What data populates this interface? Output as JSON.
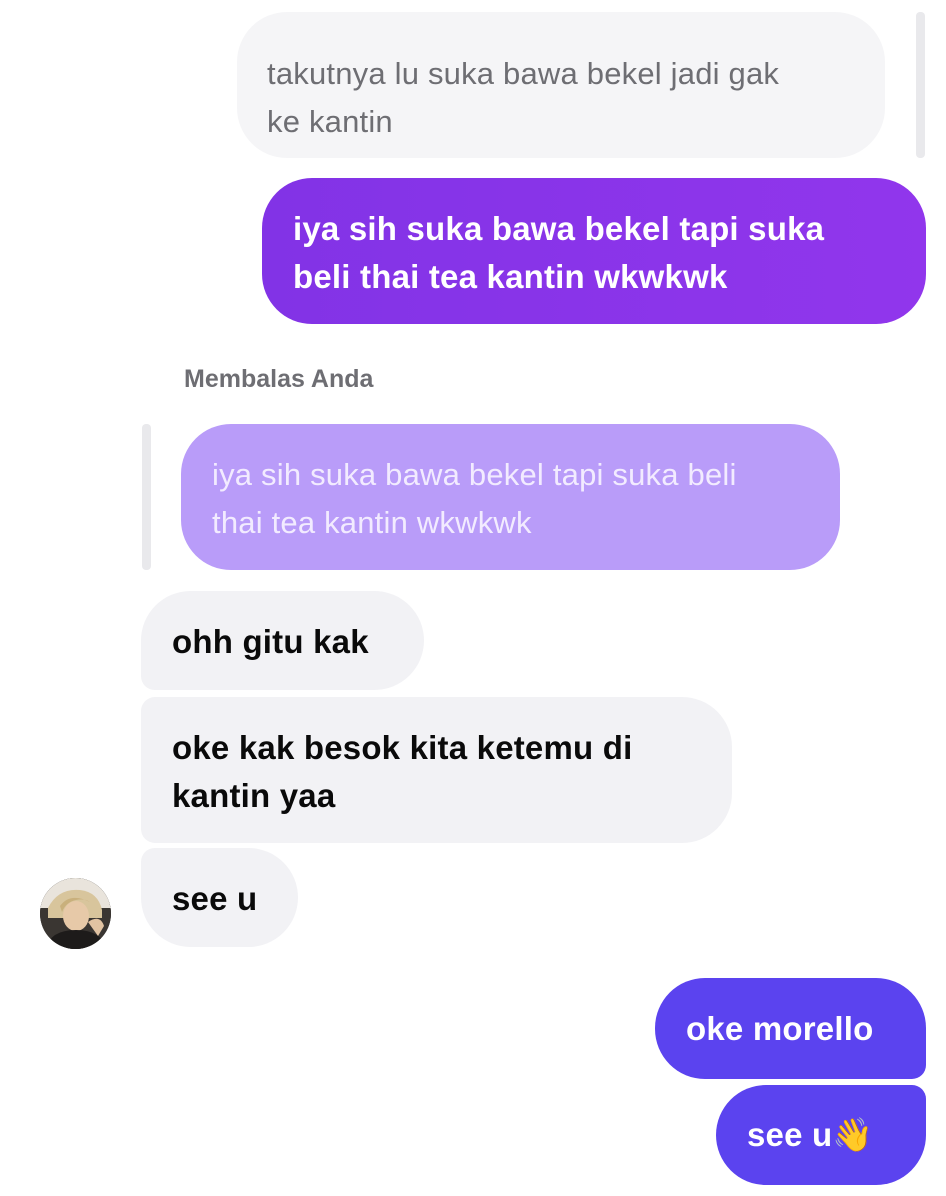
{
  "thread": {
    "quoted_top": {
      "text": "takutnya lu suka bawa bekel jadi gak\nke kantin"
    },
    "sent_message": {
      "text": "iya sih suka bawa bekel tapi suka\nbeli thai tea kantin wkwkwk"
    },
    "reply_context": {
      "label": "Membalas Anda",
      "quoted_text": "iya sih suka bawa bekel tapi suka beli\nthai tea kantin wkwkwk"
    },
    "received": [
      {
        "text": "ohh gitu kak"
      },
      {
        "text": "oke kak besok kita ketemu di\nkantin yaa"
      },
      {
        "text": "see u"
      }
    ],
    "sent": [
      {
        "text": "oke morello"
      },
      {
        "text": "see u👋"
      }
    ]
  },
  "colors": {
    "sent_purple": "#8a35e9",
    "quoted_purple": "#b99cf9",
    "sent_blue": "#5b43ef",
    "received_bg": "#f2f2f5",
    "quoted_bg": "#f5f5f7"
  },
  "icons": {
    "avatar": "contact-avatar-photo"
  }
}
